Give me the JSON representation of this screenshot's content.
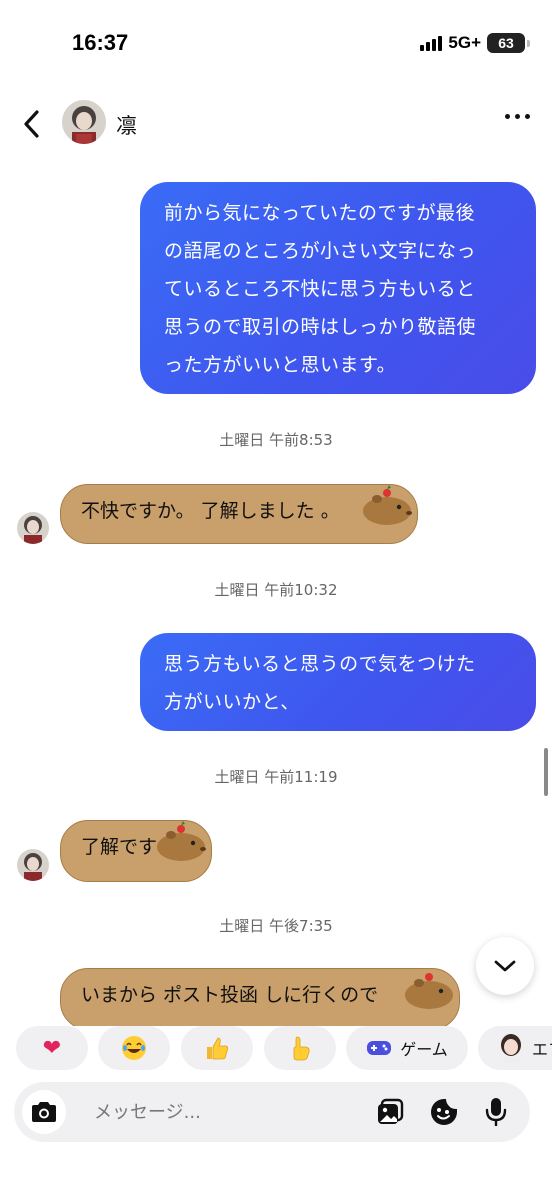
{
  "status_bar": {
    "time": "16:37",
    "network": "5G+",
    "battery": "63"
  },
  "header": {
    "contact_name": "凛"
  },
  "messages": [
    {
      "direction": "outgoing",
      "lines": [
        "前から気になっていたのですが最後",
        "の語尾のところが小さい文字になっ",
        "ているところ不快に思う方もいると",
        "思うので取引の時はしっかり敬語使",
        "った方がいいと思います。"
      ]
    },
    {
      "type": "timestamp",
      "text": "土曜日 午前8:53"
    },
    {
      "direction": "incoming",
      "text": "不快ですか。 了解しました 。"
    },
    {
      "type": "timestamp",
      "text": "土曜日 午前10:32"
    },
    {
      "direction": "outgoing",
      "lines": [
        "思う方もいると思うので気をつけた",
        "方がいいかと、"
      ]
    },
    {
      "type": "timestamp",
      "text": "土曜日 午前11:19"
    },
    {
      "direction": "incoming",
      "text": "了解です"
    },
    {
      "type": "timestamp",
      "text": "土曜日 午後7:35"
    },
    {
      "direction": "incoming",
      "text": "いまから ポスト投函 しに行くので"
    }
  ],
  "reactions": [
    {
      "icon": "heart-icon",
      "glyph": "❤"
    },
    {
      "icon": "laughing-face-icon",
      "glyph": "😂"
    },
    {
      "icon": "thumbs-up-icon",
      "glyph": "👍"
    },
    {
      "icon": "pointing-hand-icon",
      "glyph": "👆"
    },
    {
      "icon": "game-controller-icon",
      "label": "ゲーム"
    },
    {
      "icon": "avatar-effect-icon",
      "label": "エフ"
    }
  ],
  "composer": {
    "placeholder": "メッセージ..."
  },
  "colors": {
    "outgoing_bubble": "#3f55ee",
    "incoming_bubble": "#c9a06b",
    "timestamp": "#666666",
    "chip_bg": "#f0f0f2"
  }
}
